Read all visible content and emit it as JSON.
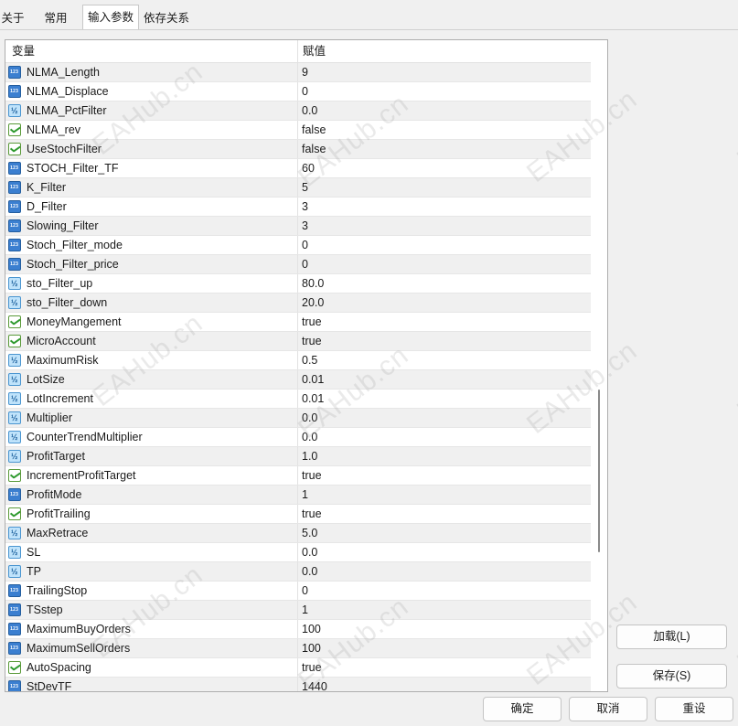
{
  "tabs": [
    {
      "label": "关于",
      "active": false
    },
    {
      "label": "常用",
      "active": false
    },
    {
      "label": "输入参数",
      "active": true
    },
    {
      "label": "依存关系",
      "active": false
    }
  ],
  "table": {
    "columns": {
      "variable": "变量",
      "value": "赋值"
    },
    "rows": [
      {
        "name": "NLMA_Length",
        "value": "9",
        "type": "int"
      },
      {
        "name": "NLMA_Displace",
        "value": "0",
        "type": "int"
      },
      {
        "name": "NLMA_PctFilter",
        "value": "0.0",
        "type": "double"
      },
      {
        "name": "NLMA_rev",
        "value": "false",
        "type": "bool"
      },
      {
        "name": "UseStochFilter",
        "value": "false",
        "type": "bool"
      },
      {
        "name": "STOCH_Filter_TF",
        "value": "60",
        "type": "int"
      },
      {
        "name": "K_Filter",
        "value": "5",
        "type": "int"
      },
      {
        "name": "D_Filter",
        "value": "3",
        "type": "int"
      },
      {
        "name": "Slowing_Filter",
        "value": "3",
        "type": "int"
      },
      {
        "name": "Stoch_Filter_mode",
        "value": "0",
        "type": "int"
      },
      {
        "name": "Stoch_Filter_price",
        "value": "0",
        "type": "int"
      },
      {
        "name": "sto_Filter_up",
        "value": "80.0",
        "type": "double"
      },
      {
        "name": "sto_Filter_down",
        "value": "20.0",
        "type": "double"
      },
      {
        "name": "MoneyMangement",
        "value": "true",
        "type": "bool"
      },
      {
        "name": "MicroAccount",
        "value": "true",
        "type": "bool"
      },
      {
        "name": "MaximumRisk",
        "value": "0.5",
        "type": "double"
      },
      {
        "name": "LotSize",
        "value": "0.01",
        "type": "double"
      },
      {
        "name": "LotIncrement",
        "value": "0.01",
        "type": "double"
      },
      {
        "name": "Multiplier",
        "value": "0.0",
        "type": "double"
      },
      {
        "name": "CounterTrendMultiplier",
        "value": "0.0",
        "type": "double"
      },
      {
        "name": "ProfitTarget",
        "value": "1.0",
        "type": "double"
      },
      {
        "name": "IncrementProfitTarget",
        "value": "true",
        "type": "bool"
      },
      {
        "name": "ProfitMode",
        "value": "1",
        "type": "int"
      },
      {
        "name": "ProfitTrailing",
        "value": "true",
        "type": "bool"
      },
      {
        "name": "MaxRetrace",
        "value": "5.0",
        "type": "double"
      },
      {
        "name": "SL",
        "value": "0.0",
        "type": "double"
      },
      {
        "name": "TP",
        "value": "0.0",
        "type": "double"
      },
      {
        "name": "TrailingStop",
        "value": "0",
        "type": "int"
      },
      {
        "name": "TSstep",
        "value": "1",
        "type": "int"
      },
      {
        "name": "MaximumBuyOrders",
        "value": "100",
        "type": "int"
      },
      {
        "name": "MaximumSellOrders",
        "value": "100",
        "type": "int"
      },
      {
        "name": "AutoSpacing",
        "value": "true",
        "type": "bool"
      },
      {
        "name": "StDevTF",
        "value": "1440",
        "type": "int"
      }
    ]
  },
  "side_buttons": {
    "load": "加载(L)",
    "save": "保存(S)"
  },
  "bottom_buttons": {
    "ok": "确定",
    "cancel": "取消",
    "reset": "重设"
  },
  "watermark": {
    "text": "EAHub.cn"
  },
  "colors": {
    "int_icon": "#3b7fd0",
    "double_icon": "#bfe3fb",
    "bool_icon": "#2f9a2f"
  }
}
